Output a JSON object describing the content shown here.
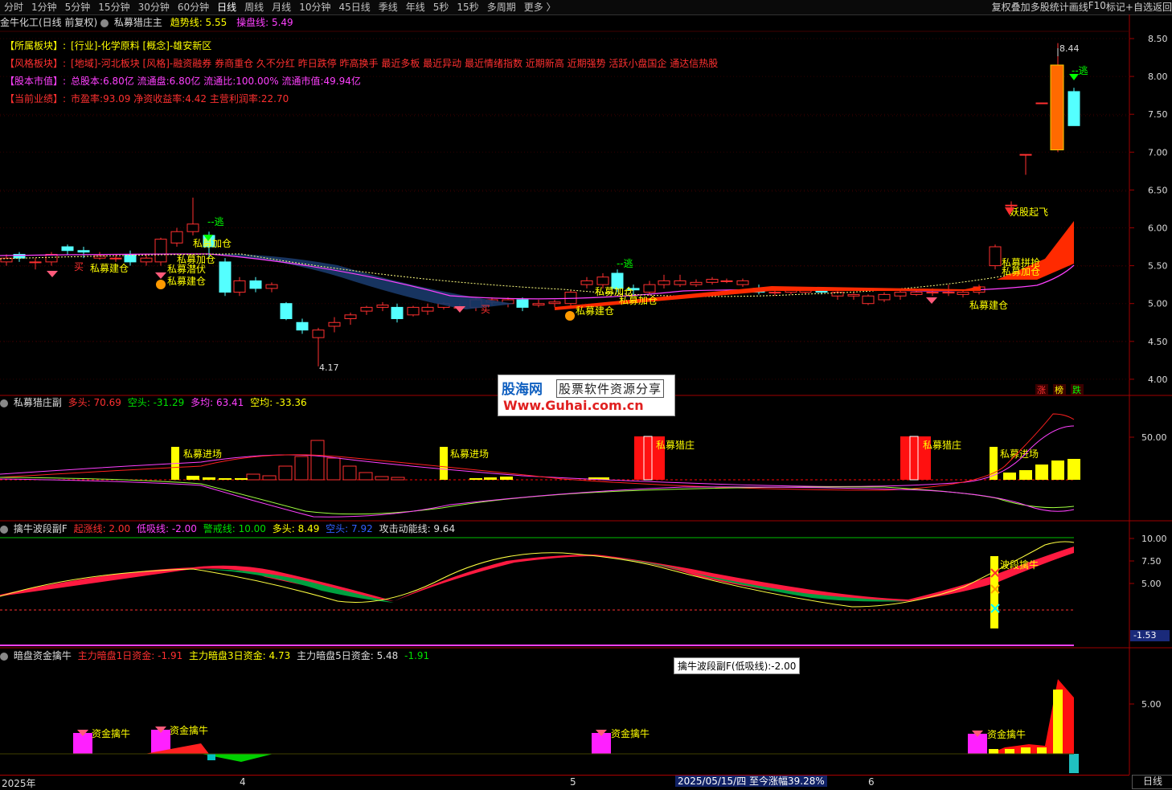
{
  "topbar": {
    "tabs": [
      "分时",
      "1分钟",
      "5分钟",
      "15分钟",
      "30分钟",
      "60分钟",
      "日线",
      "周线",
      "月线",
      "10分钟",
      "45日线",
      "季线",
      "年线",
      "5秒",
      "15秒",
      "多周期",
      "更多 〉"
    ],
    "active_tab": "日线",
    "right_buttons": [
      "复权",
      "叠加",
      "多股",
      "统计",
      "画线",
      "F10",
      "标记",
      "+自选",
      "返回"
    ]
  },
  "main_panel": {
    "title": "金牛化工(日线 前复权)",
    "indicator": "私募猎庄主",
    "trend_label": "趋势线: 5.55",
    "trade_label": "操盘线: 5.49",
    "info": [
      {
        "key": "【所属板块】:",
        "val": "[行业]-化学原料 [概念]-雄安新区"
      },
      {
        "key": "【风格板块】:",
        "val": "[地域]-河北板块 [风格]-融资融券 券商重仓 久不分红 昨日跌停 昨高换手 最近多板 最近异动 最近情绪指数 近期新高 近期强势 活跃小盘国企 通达信热股"
      },
      {
        "key": "【股本市值】:",
        "val": "总股本:6.80亿 流通盘:6.80亿 流通比:100.00% 流通市值:49.94亿"
      },
      {
        "key": "【当前业绩】:",
        "val": "市盈率:93.09 净资收益率:4.42 主营利润率:22.70"
      }
    ],
    "y_labels": [
      "8.50",
      "8.00",
      "7.50",
      "7.00",
      "6.50",
      "6.00",
      "5.50",
      "5.00",
      "4.50",
      "4.00"
    ],
    "annotations": {
      "high": "8.44",
      "low": "4.17",
      "escape": "--逃",
      "buy": "买",
      "jian_cang": "私募建仓",
      "jia_cang": "私募加仓",
      "qian_fu": "私募潜伏",
      "qi_fei": "妖股起飞",
      "gong_zhan": "私募拼抢"
    },
    "badges": [
      "涨",
      "榜",
      "跌"
    ]
  },
  "panel2": {
    "title": "私募猎庄副",
    "duo": "多头: 70.69",
    "kong": "空头: -31.29",
    "duo_jun": "多均: 63.41",
    "kong_jun": "空均: -33.36",
    "y_label": "50.00",
    "labels": {
      "jinchang": "私募进场",
      "liezhuang": "私募猎庄"
    }
  },
  "panel3": {
    "title": "擒牛波段副F",
    "qizhang": "起涨线: 2.00",
    "dixi": "低吸线: -2.00",
    "jingjie": "警戒线: 10.00",
    "duotou": "多头: 8.49",
    "kongtou": "空头: 7.92",
    "gongji": "攻击动能线: 9.64",
    "y_labels": [
      "10.00",
      "7.50",
      "5.00"
    ],
    "neg_label": "-1.53",
    "qinniu": "波段擒牛"
  },
  "panel4": {
    "title": "暗盘资金擒牛",
    "d1": "主力暗盘1日资金: -1.91",
    "d3": "主力暗盘3日资金: 4.73",
    "d5": "主力暗盘5日资金: 5.48",
    "extra": "-1.91",
    "y_label": "5.00",
    "label": "资金擒牛",
    "tooltip": "擒牛波段副F(低吸线):-2.00"
  },
  "watermark": {
    "brand": "股海网",
    "slogan": "股票软件资源分享",
    "url": "Www.Guhai.com.cn"
  },
  "bottom": {
    "year": "2025年",
    "m4": "4",
    "m5": "5",
    "m6": "6",
    "date": "2025/05/15/四  至今涨幅39.28%",
    "period": "日线"
  },
  "colors": {
    "up": "#ff3030",
    "down": "#54ffff",
    "yellow": "#ffff00",
    "magenta": "#ff00ff",
    "green": "#00c000"
  }
}
